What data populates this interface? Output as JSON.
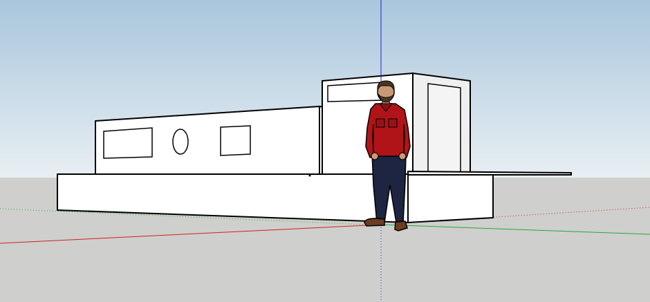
{
  "viewport": {
    "colors": {
      "sky_top": "#a9c6dc",
      "sky_bottom": "#e9eff3",
      "ground": "#cfcfcd",
      "edge": "#000000",
      "face_white": "#ffffff",
      "face_shade": "#efefef",
      "axis_red": "#cc2222",
      "axis_green": "#22aa33",
      "axis_blue": "#2222cc"
    }
  },
  "axes": {
    "red": "#cc2222",
    "green": "#22aa33",
    "blue": "#2222cc"
  },
  "model": {
    "parts": [
      {
        "name": "base-platform",
        "shade": "#ffffff"
      },
      {
        "name": "lower-cabin",
        "shade": "#ffffff"
      },
      {
        "name": "upper-cabin",
        "shade": "#ffffff"
      },
      {
        "name": "deck-extension",
        "shade": "#efefef"
      }
    ],
    "openings": [
      "window-left",
      "porthole",
      "window-right",
      "upper-window",
      "door"
    ]
  },
  "scale_figure": {
    "name": "person-figure",
    "shirt_color": "#b01418",
    "pants_color": "#1d2540",
    "skin_color": "#c79a73",
    "hair_color": "#4a3524",
    "shoe_color": "#6b3e22"
  }
}
